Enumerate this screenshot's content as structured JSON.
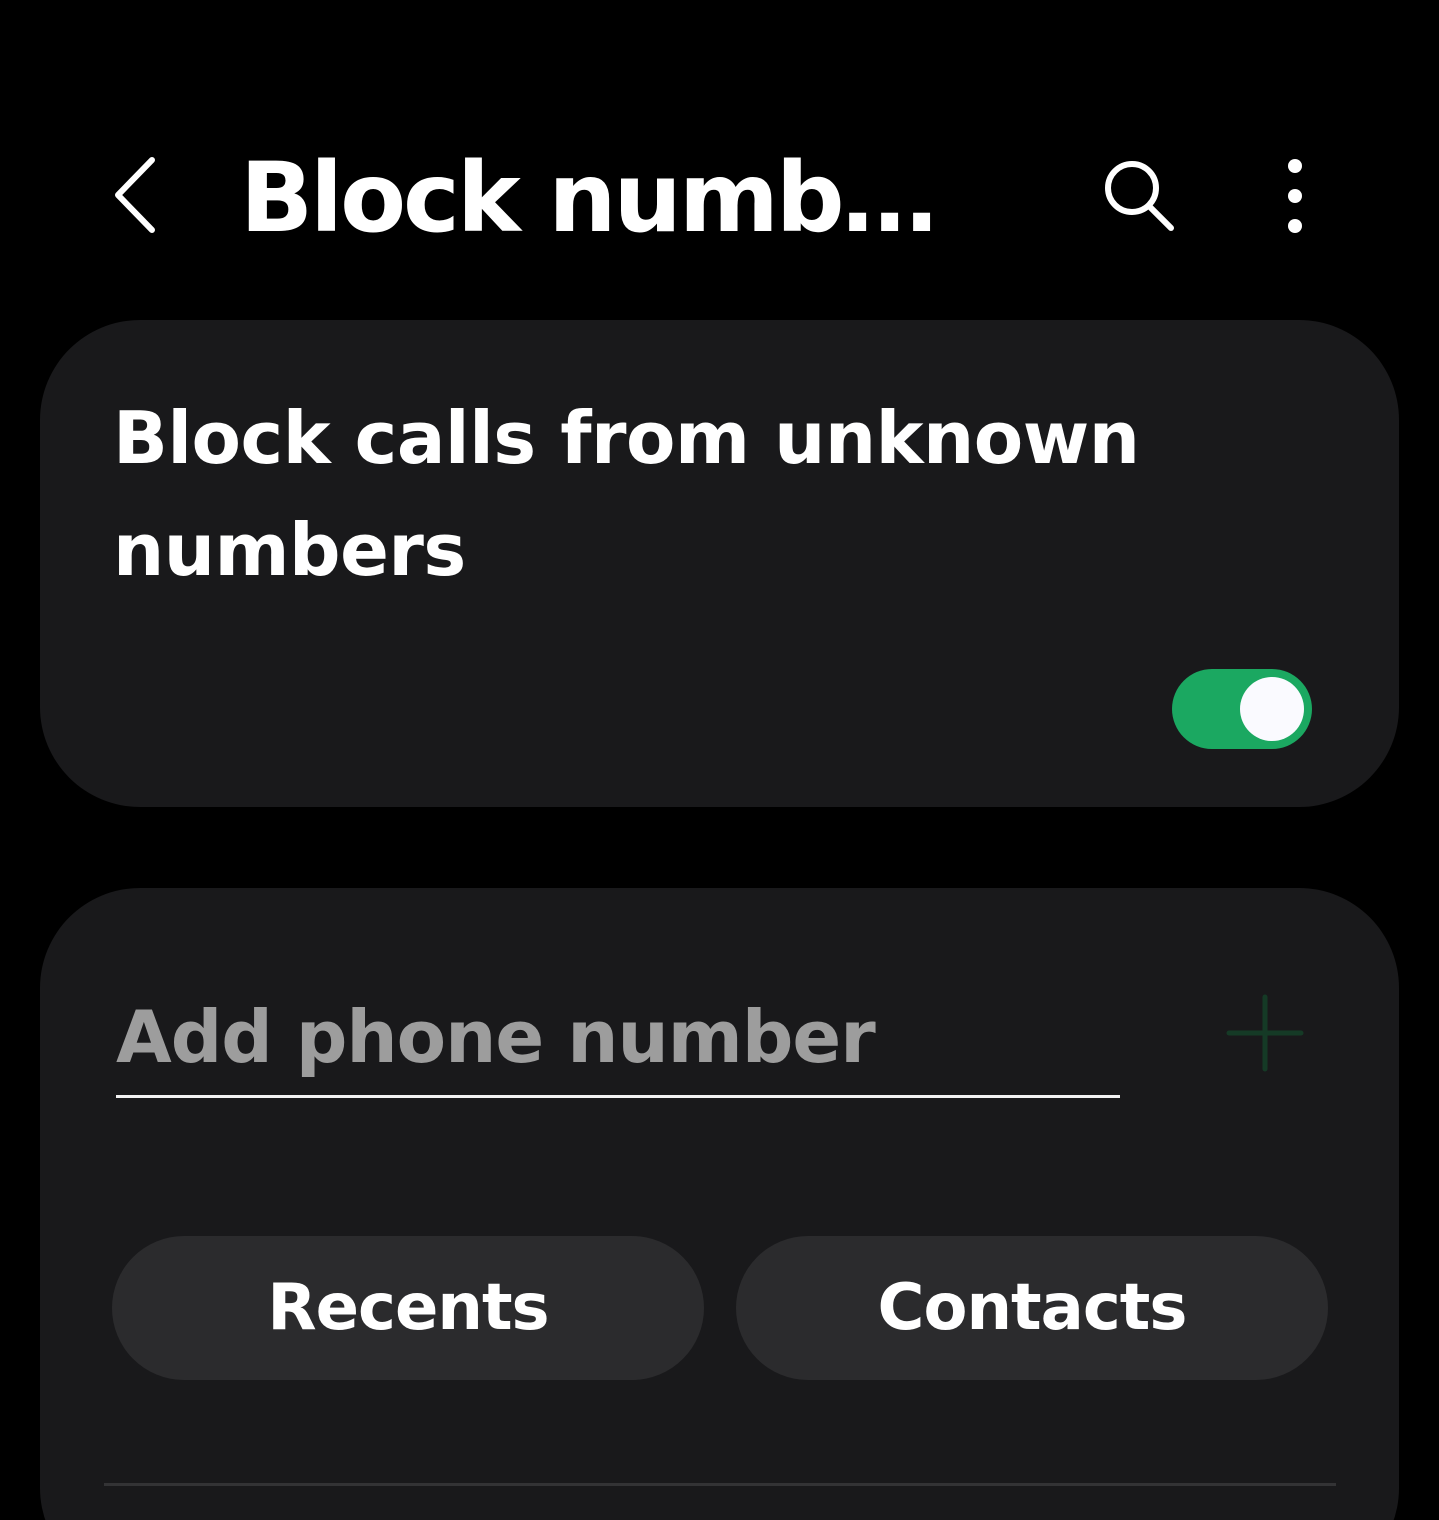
{
  "header": {
    "title": "Block numb…",
    "back_icon": "chevron-left-icon",
    "search_icon": "search-icon",
    "more_icon": "more-vertical-icon"
  },
  "block_unknown": {
    "label": "Block calls from unknown numbers",
    "enabled": true
  },
  "add_number": {
    "placeholder": "Add phone number",
    "value": "",
    "add_icon": "plus-icon"
  },
  "buttons": {
    "recents": "Recents",
    "contacts": "Contacts"
  },
  "colors": {
    "background": "#000000",
    "card": "#19191b",
    "toggle_on": "#1ba861",
    "pill": "#2b2b2d",
    "add_icon": "#153a26"
  }
}
